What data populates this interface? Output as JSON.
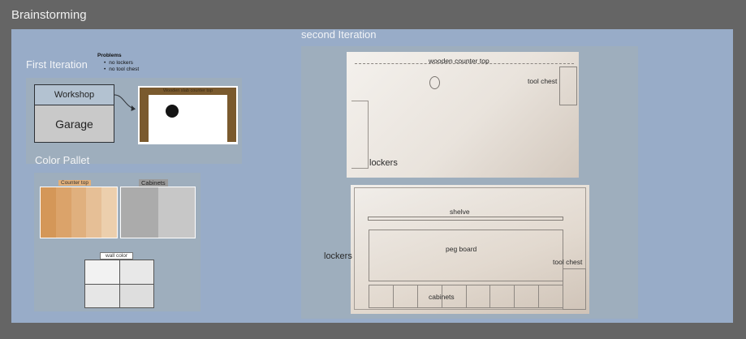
{
  "board": {
    "title": "Brainstorming"
  },
  "first_iteration": {
    "title": "First Iteration",
    "problems_heading": "Problems",
    "problems": [
      "no lockers",
      "no tool chest"
    ],
    "workshop_label": "Workshop",
    "garage_label": "Garage",
    "counter_label": "Wooden slab counter top"
  },
  "color_pallet": {
    "title": "Color Pallet",
    "counter_top_label": "Counter top",
    "cabinets_label": "Cabinets",
    "wall_color_label": "wall color",
    "counter_top_colors": [
      "#d49758",
      "#dba36a",
      "#e0b07e",
      "#e6bf96",
      "#eccfad"
    ],
    "cabinet_colors": [
      "#ababab",
      "#c7c7c7"
    ],
    "wall_colors": [
      "#f2f2f2",
      "#e8e8e8",
      "#e6e6e6",
      "#dedede"
    ]
  },
  "second_iteration": {
    "title": "second Iteration",
    "sketch1": {
      "counter": "wooden counter top",
      "tool_chest": "tool chest",
      "lockers": "lockers"
    },
    "sketch2": {
      "shelve": "shelve",
      "peg_board": "peg board",
      "tool_chest": "tool chest",
      "cabinets": "cabinets",
      "lockers": "lockers"
    }
  }
}
